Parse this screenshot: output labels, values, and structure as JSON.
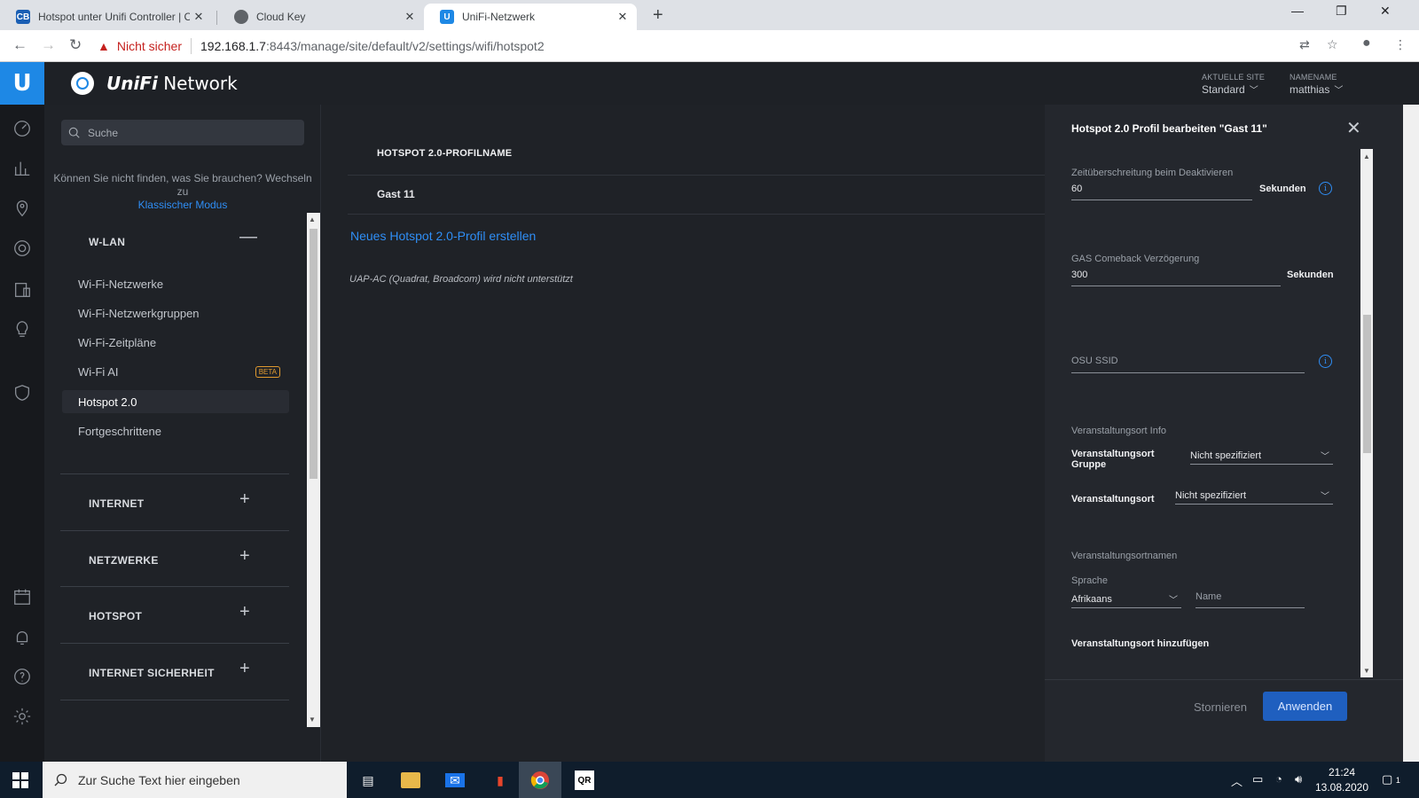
{
  "browser": {
    "tabs": [
      {
        "title": "Hotspot unter Unifi Controller | C",
        "favicon": "CB"
      },
      {
        "title": "Cloud Key",
        "favicon": "globe"
      },
      {
        "title": "UniFi-Netzwerk",
        "favicon": "U"
      }
    ],
    "security_label": "Nicht sicher",
    "url_host": "192.168.1.7",
    "url_path": ":8443/manage/site/default/v2/settings/wifi/hotspot2"
  },
  "header": {
    "brand": "Network",
    "brand_prefix": "UniFi",
    "site_caption": "AKTUELLE SITE",
    "site_value": "Standard",
    "user_caption": "NAMENAME",
    "user_value": "matthias"
  },
  "sidebar": {
    "search_placeholder": "Suche",
    "hint_text": "Können Sie nicht finden, was Sie brauchen? Wechseln zu",
    "hint_link": "Klassischer Modus",
    "wlan_header": "W-LAN",
    "wlan_items": [
      {
        "label": "Wi-Fi-Netzwerke"
      },
      {
        "label": "Wi-Fi-Netzwerkgruppen"
      },
      {
        "label": "Wi-Fi-Zeitpläne"
      },
      {
        "label": "Wi-Fi AI",
        "badge": "BETA"
      },
      {
        "label": "Hotspot 2.0"
      },
      {
        "label": "Fortgeschrittene"
      }
    ],
    "sections": [
      {
        "label": "INTERNET"
      },
      {
        "label": "NETZWERKE"
      },
      {
        "label": "HOTSPOT"
      },
      {
        "label": "INTERNET SICHERHEIT"
      }
    ]
  },
  "main": {
    "column_header": "HOTSPOT 2.0-PROFILNAME",
    "rows": [
      "Gast 11"
    ],
    "create_link": "Neues Hotspot 2.0-Profil erstellen",
    "unsupported_note": "UAP-AC (Quadrat, Broadcom) wird nicht unterstützt"
  },
  "panel": {
    "title": "Hotspot 2.0 Profil bearbeiten \"Gast 11\"",
    "timeout_label": "Zeitüberschreitung beim Deaktivieren",
    "timeout_value": "60",
    "timeout_unit": "Sekunden",
    "gas_label": "GAS Comeback Verzögerung",
    "gas_value": "300",
    "gas_unit": "Sekunden",
    "osu_placeholder": "OSU SSID",
    "venue_info_label": "Veranstaltungsort Info",
    "venue_group_label": "Veranstaltungsort Gruppe",
    "venue_group_value": "Nicht spezifiziert",
    "venue_label": "Veranstaltungsort",
    "venue_value": "Nicht spezifiziert",
    "venue_names_label": "Veranstaltungsortnamen",
    "language_label": "Sprache",
    "language_value": "Afrikaans",
    "name_placeholder": "Name",
    "add_venue": "Veranstaltungsort hinzufügen",
    "cancel": "Stornieren",
    "apply": "Anwenden"
  },
  "taskbar": {
    "search_placeholder": "Zur Suche Text hier eingeben",
    "time": "21:24",
    "date": "13.08.2020",
    "notification_count": "1"
  }
}
